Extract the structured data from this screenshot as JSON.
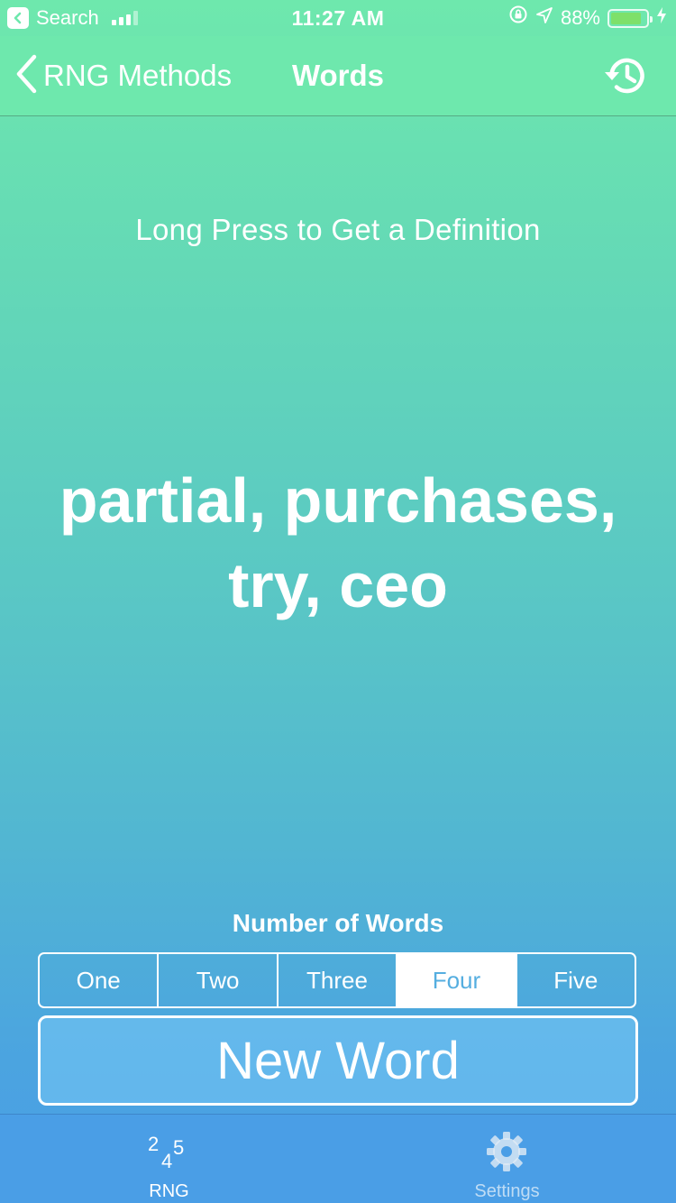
{
  "status_bar": {
    "back_app": "Search",
    "time": "11:27 AM",
    "battery": "88%",
    "battery_level": 0.88
  },
  "nav": {
    "back_label": "RNG Methods",
    "title": "Words",
    "history_icon": "history-icon"
  },
  "content": {
    "hint": "Long Press to Get a Definition",
    "result": "partial, purchases, try, ceo"
  },
  "controls": {
    "segment_title": "Number of Words",
    "segments": [
      "One",
      "Two",
      "Three",
      "Four",
      "Five"
    ],
    "selected_segment": "Four",
    "button_label": "New Word"
  },
  "tab_bar": {
    "items": [
      {
        "label": "RNG",
        "icon": "rng-numbers-icon",
        "selected": true
      },
      {
        "label": "Settings",
        "icon": "gear-icon",
        "selected": false
      }
    ]
  },
  "colors": {
    "gradient_top": "#6ee8ad",
    "gradient_bottom": "#4a9ee6",
    "segment_selected_text": "#55aee0",
    "battery_fill": "#7ee06a"
  }
}
